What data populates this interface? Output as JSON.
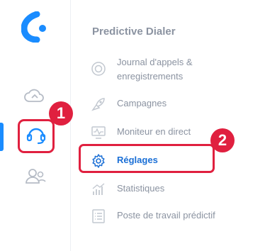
{
  "rail": {
    "items": [
      {
        "name": "cloud",
        "active": false
      },
      {
        "name": "headset",
        "active": true
      },
      {
        "name": "team",
        "active": false
      }
    ]
  },
  "callouts": [
    "1",
    "2"
  ],
  "submenu": {
    "title": "Predictive Dialer",
    "items": [
      {
        "label": "Journal d'appels & enregistrements",
        "icon": "record-icon"
      },
      {
        "label": "Campagnes",
        "icon": "rocket-icon"
      },
      {
        "label": "Moniteur en direct",
        "icon": "monitor-icon"
      },
      {
        "label": "Réglages",
        "icon": "gear-icon",
        "active": true
      },
      {
        "label": "Statistiques",
        "icon": "stats-icon"
      },
      {
        "label": "Poste de travail prédictif",
        "icon": "list-icon"
      }
    ]
  },
  "colors": {
    "accent": "#1a8cff",
    "highlight": "#e0203f",
    "muted_text": "#8b93a1",
    "active_text": "#1a6fd6"
  }
}
